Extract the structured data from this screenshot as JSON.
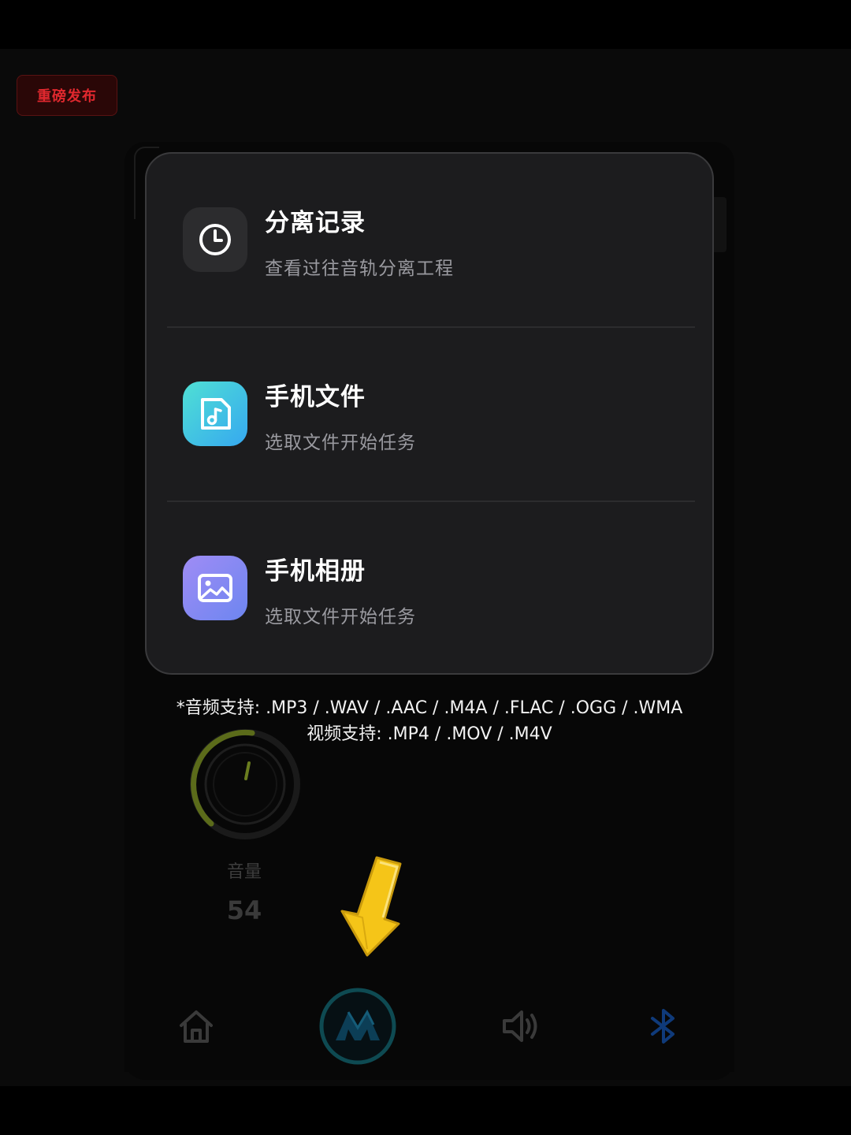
{
  "badge": {
    "label": "重磅发布"
  },
  "menu": {
    "items": [
      {
        "title": "分离记录",
        "subtitle": "查看过往音轨分离工程",
        "icon": "clock-icon"
      },
      {
        "title": "手机文件",
        "subtitle": "选取文件开始任务",
        "icon": "music-file-icon"
      },
      {
        "title": "手机相册",
        "subtitle": "选取文件开始任务",
        "icon": "photo-album-icon"
      }
    ]
  },
  "formats": {
    "audio_line": "*音频支持: .MP3 / .WAV / .AAC / .M4A / .FLAC / .OGG / .WMA",
    "video_line": "视频支持: .MP4 / .MOV / .M4V"
  },
  "volume": {
    "label": "音量",
    "value": "54",
    "level": 0.54
  },
  "nav": {
    "items": [
      {
        "name": "home",
        "icon": "home-icon"
      },
      {
        "name": "separate",
        "icon": "app-logo-icon"
      },
      {
        "name": "sound",
        "icon": "speaker-icon"
      },
      {
        "name": "bluetooth",
        "icon": "bluetooth-icon"
      }
    ]
  },
  "colors": {
    "badge_text": "#e0282e",
    "file_icon_gradient": [
      "#4fe0d4",
      "#36a8f0"
    ],
    "album_icon_gradient": [
      "#9f8cf5",
      "#6d86f0"
    ],
    "arrow": "#f5c518",
    "dial_arc": "#6a7d1f"
  }
}
